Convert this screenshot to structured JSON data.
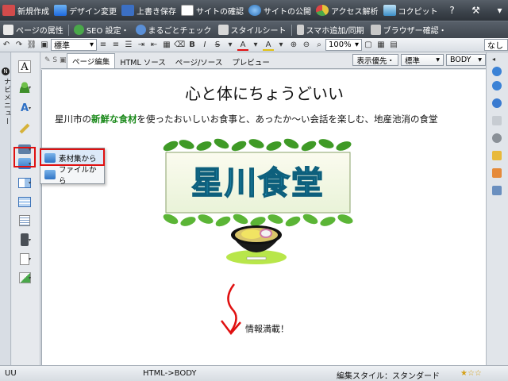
{
  "toolbar": {
    "items": [
      {
        "label": "新規作成",
        "icon": "new-file-icon"
      },
      {
        "label": "デザイン変更",
        "icon": "design-icon"
      },
      {
        "label": "上書き保存",
        "icon": "save-icon"
      },
      {
        "label": "サイトの確認",
        "icon": "site-check-icon"
      },
      {
        "label": "サイトの公開",
        "icon": "publish-icon"
      },
      {
        "label": "アクセス解析",
        "icon": "analytics-icon"
      },
      {
        "label": "コクピット",
        "icon": "cockpit-icon"
      }
    ],
    "help_icon": "help-icon",
    "tools_icon": "tools-icon"
  },
  "second_toolbar": {
    "items": [
      {
        "label": "ページの属性",
        "icon": "page-attr-icon"
      },
      {
        "label": "SEO 設定・",
        "icon": "seo-icon"
      },
      {
        "label": "まるごとチェック",
        "icon": "check-icon"
      },
      {
        "label": "スタイルシート",
        "icon": "stylesheet-icon"
      },
      {
        "label": "スマホ追加/同期",
        "icon": "smartphone-icon"
      },
      {
        "label": "ブラウザー確認・",
        "icon": "browser-icon"
      }
    ]
  },
  "format_bar": {
    "style_select": "標準",
    "zoom_select": "100%",
    "font_select": "なし"
  },
  "nav": {
    "label": "ナビメニュー"
  },
  "tabs": {
    "items": [
      {
        "label": "ページ編集",
        "active": true
      },
      {
        "label": "HTML ソース",
        "active": false
      },
      {
        "label": "ページ/ソース",
        "active": false
      },
      {
        "label": "プレビュー",
        "active": false
      }
    ],
    "display_priority": "表示優先・",
    "standard_select": "標準",
    "tag_select": "BODY"
  },
  "page": {
    "title": "心と体にちょうどいい",
    "intro_before": "星川市の",
    "intro_highlight": "新鮮な食材",
    "intro_after": "を使ったおいしいお食事と、あったか〜い会話を楽しむ、地産池消の食堂",
    "banner_text": "星川食堂",
    "caption": "情報満載！"
  },
  "popup_menu": {
    "items": [
      {
        "label": "素材集から",
        "highlighted": true
      },
      {
        "label": "ファイルから",
        "highlighted": false
      }
    ]
  },
  "status_bar": {
    "mode": "UU",
    "path": "HTML->BODY",
    "edit_style": "編集スタイル：スタンダード"
  },
  "colors": {
    "highlight_green": "#1c8a1c",
    "accent_red": "#e01010",
    "banner_text": "#2fb3e0",
    "toolbar_dark": "#3d444c"
  }
}
